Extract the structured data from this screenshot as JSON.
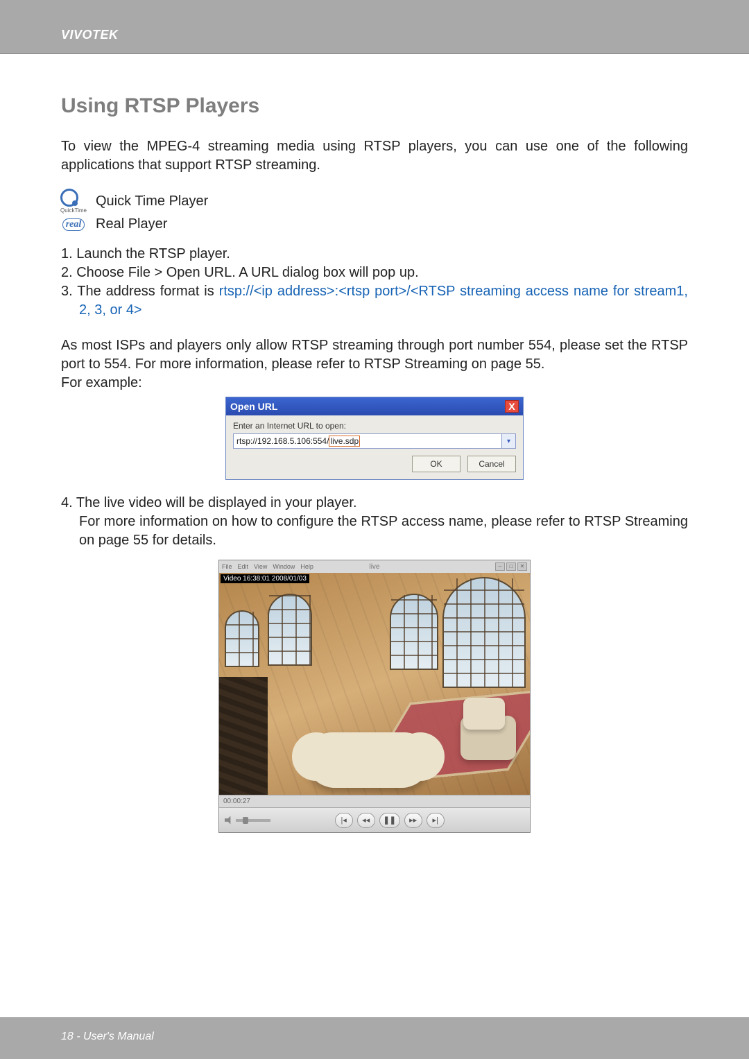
{
  "header": {
    "brand": "VIVOTEK"
  },
  "section_title": "Using RTSP Players",
  "intro": "To view the MPEG-4 streaming media using RTSP players, you can use one of the following applications that support RTSP streaming.",
  "players": {
    "quicktime_label": "Quick Time Player",
    "quicktime_caption": "QuickTime",
    "real_label": "Real Player",
    "real_icon_text": "real"
  },
  "steps": {
    "s1": "1. Launch the RTSP player.",
    "s2": "2. Choose File > Open URL. A URL dialog box will pop up.",
    "s3_prefix": "3. The address format is ",
    "s3_url": "rtsp://<ip address>:<rtsp port>/<RTSP streaming access name for stream1, 2, 3, or 4>"
  },
  "note_port": "As most ISPs and players only allow RTSP streaming through port number 554, please set the RTSP port to 554. For more information, please refer to RTSP Streaming on page 55.",
  "for_example": "For example:",
  "dialog": {
    "title": "Open URL",
    "label": "Enter an Internet URL to open:",
    "url_prefix": "rtsp://192.168.5.106:554/",
    "url_highlight": "live.sdp",
    "ok": "OK",
    "cancel": "Cancel",
    "close": "X",
    "dropdown": "▾"
  },
  "step4": {
    "line1": "4. The live video will be displayed in your player.",
    "line2": "For more information on how to configure the RTSP access name, please refer to RTSP Streaming on page 55 for details."
  },
  "videoplayer": {
    "menu": {
      "file": "File",
      "edit": "Edit",
      "view": "View",
      "window": "Window",
      "help": "Help"
    },
    "title": "live",
    "overlay": "Video 16:38:01 2008/01/03",
    "time": "00:00:27",
    "buttons": {
      "start": "|◂",
      "rev": "◂◂",
      "pause": "❚❚",
      "fwd": "▸▸",
      "end": "▸|"
    },
    "win": {
      "min": "–",
      "max": "□",
      "close": "✕"
    }
  },
  "footer": {
    "text": "18 - User's Manual"
  }
}
